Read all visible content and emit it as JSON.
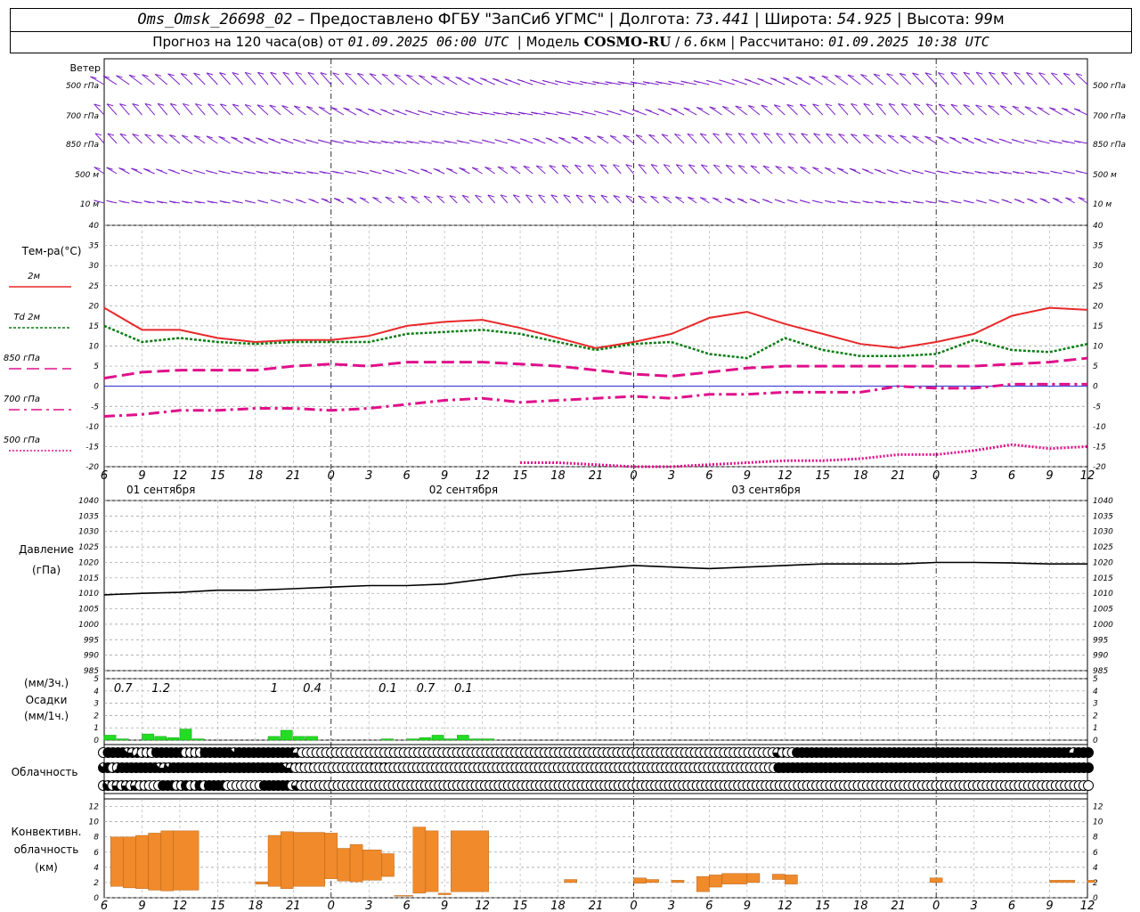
{
  "header": {
    "station": "Oms_Omsk_26698_02",
    "sep": " – ",
    "provider": "Предоставлено ФГБУ \"ЗапСиб УГМС\"",
    "lon_label": "Долгота:",
    "lon": "73.441",
    "lat_label": "Широта:",
    "lat": "54.925",
    "alt_label": "Высота:",
    "alt": "99",
    "alt_unit": "м",
    "forecast_label": "Прогноз на 120 часа(ов) от",
    "forecast_start": "01.09.2025 06:00 UTC",
    "model_label": "Модель",
    "model": "COSMO-RU",
    "resolution": "6.6",
    "resolution_unit": "км",
    "calc_label": "Рассчитано:",
    "calc_time": "01.09.2025 10:38 UTC"
  },
  "colors": {
    "wind": "#7b20c8",
    "t2m": "#e8282a",
    "td2m": "#0a7d14",
    "t850": "#e0108a",
    "t700": "#e0108a",
    "t500": "#e0108a",
    "pressure": "#000000",
    "precip": "#22dd22",
    "convective": "#f08a2a",
    "zero_line": "#2020d0"
  },
  "chart_data": [
    {
      "type": "wind_barbs",
      "title": "Ветер",
      "levels": [
        "500 гПа",
        "700 гПа",
        "850 гПа",
        "500 м",
        "10 м"
      ]
    },
    {
      "type": "line",
      "ylabel": "Тем-ра(°C)",
      "ylim": [
        -20,
        40
      ],
      "yticks": [
        -20,
        -15,
        -10,
        -5,
        0,
        5,
        10,
        15,
        20,
        25,
        30,
        35,
        40
      ],
      "x_hours": [
        0,
        3,
        6,
        9,
        12,
        15,
        18,
        21,
        24,
        27,
        30,
        33,
        36,
        39,
        42,
        45,
        48,
        51,
        54,
        57,
        60,
        63,
        66,
        69,
        72,
        75,
        78
      ],
      "x_tick_labels": [
        "6",
        "9",
        "12",
        "15",
        "18",
        "21",
        "0",
        "3",
        "6",
        "9",
        "12",
        "15",
        "18",
        "21",
        "0",
        "3",
        "6",
        "9",
        "12",
        "15",
        "18",
        "21",
        "0",
        "3",
        "6",
        "9",
        "12"
      ],
      "date_labels": [
        "01 сентября",
        "02 сентября",
        "03 сентября"
      ],
      "grid": true,
      "series": [
        {
          "name": "2м",
          "values": [
            19.5,
            14,
            14,
            12,
            11,
            11.5,
            11.5,
            12.5,
            15,
            16,
            16.5,
            14.5,
            12,
            9.5,
            11,
            13,
            17,
            18.5,
            15.5,
            13,
            10.5,
            9.5,
            11,
            13,
            17.5,
            19.5,
            19
          ]
        },
        {
          "name": "Td 2м",
          "values": [
            15,
            11,
            12,
            11,
            10.5,
            11,
            11,
            11,
            13,
            13.5,
            14,
            13,
            11,
            9,
            10.5,
            11,
            8,
            7,
            12,
            9,
            7.5,
            7.5,
            8,
            11.5,
            9,
            8.5,
            10.5
          ]
        },
        {
          "name": "850 гПа",
          "values": [
            2,
            3.5,
            4,
            4,
            4,
            5,
            5.5,
            5,
            6,
            6,
            6,
            5.5,
            5,
            4,
            3,
            2.5,
            3.5,
            4.5,
            5,
            5,
            5,
            5,
            5,
            5,
            5.5,
            6,
            7
          ]
        },
        {
          "name": "700 гПа",
          "values": [
            -7.5,
            -7,
            -6,
            -6,
            -5.5,
            -5.5,
            -6,
            -5.5,
            -4.5,
            -3.5,
            -3,
            -4,
            -3.5,
            -3,
            -2.5,
            -3,
            -2,
            -2,
            -1.5,
            -1.5,
            -1.5,
            0,
            -0.5,
            -0.5,
            0.5,
            0.5,
            0.5
          ]
        },
        {
          "name": "500 гПа",
          "values": [
            null,
            null,
            null,
            null,
            null,
            null,
            null,
            null,
            null,
            null,
            null,
            -19,
            -19,
            -19.5,
            -20,
            -20,
            -19.5,
            -19,
            -18.5,
            -18.5,
            -18,
            -17,
            -17,
            -16,
            -14.5,
            -15.5,
            -15
          ]
        }
      ]
    },
    {
      "type": "line",
      "ylabel": "Давление",
      "unit": "(гПа)",
      "ylim": [
        985,
        1040
      ],
      "yticks": [
        985,
        990,
        995,
        1000,
        1005,
        1010,
        1015,
        1020,
        1025,
        1030,
        1035,
        1040
      ],
      "grid": true,
      "series": [
        {
          "values": [
            1009.5,
            1010,
            1010.3,
            1011,
            1011,
            1011.5,
            1012,
            1012.5,
            1012.5,
            1013,
            1014.5,
            1016,
            1017,
            1018,
            1019,
            1018.5,
            1018,
            1018.5,
            1019,
            1019.5,
            1019.5,
            1019.5,
            1020,
            1020,
            1019.8,
            1019.5,
            1019.5
          ]
        }
      ]
    },
    {
      "type": "bar",
      "ylabel": "Осадки",
      "unit_top": "(мм/3ч.)",
      "unit_bottom": "(мм/1ч.)",
      "ylim": [
        0,
        5
      ],
      "yticks": [
        0,
        1,
        2,
        3,
        4,
        5
      ],
      "bars": [
        {
          "hour": 0,
          "value": 0.4
        },
        {
          "hour": 1,
          "value": 0.1
        },
        {
          "hour": 3,
          "value": 0.5
        },
        {
          "hour": 4,
          "value": 0.3
        },
        {
          "hour": 5,
          "value": 0.2
        },
        {
          "hour": 6,
          "value": 0.9
        },
        {
          "hour": 7,
          "value": 0.1
        },
        {
          "hour": 13,
          "value": 0.3
        },
        {
          "hour": 14,
          "value": 0.8
        },
        {
          "hour": 15,
          "value": 0.3
        },
        {
          "hour": 16,
          "value": 0.3
        },
        {
          "hour": 22,
          "value": 0.1
        },
        {
          "hour": 24,
          "value": 0.1
        },
        {
          "hour": 25,
          "value": 0.2
        },
        {
          "hour": 26,
          "value": 0.4
        },
        {
          "hour": 27,
          "value": 0.1
        },
        {
          "hour": 28,
          "value": 0.4
        },
        {
          "hour": 29,
          "value": 0.1
        },
        {
          "hour": 30,
          "value": 0.1
        }
      ],
      "labels": [
        {
          "hour": 1.5,
          "text": "0.7"
        },
        {
          "hour": 4.5,
          "text": "1.2"
        },
        {
          "hour": 13.5,
          "text": "1"
        },
        {
          "hour": 16.5,
          "text": "0.4"
        },
        {
          "hour": 22.5,
          "text": "0.1"
        },
        {
          "hour": 25.5,
          "text": "0.7"
        },
        {
          "hour": 28.5,
          "text": "0.1"
        }
      ]
    },
    {
      "type": "table",
      "title": "Облачность",
      "rows_octas": [
        [
          0,
          8,
          8,
          8,
          8,
          7,
          6,
          5,
          4,
          4,
          2,
          8,
          8,
          8,
          8,
          8,
          8,
          4,
          4,
          4,
          4,
          8,
          8,
          8,
          8,
          8,
          8,
          7,
          8,
          8,
          8,
          8,
          8,
          8,
          8,
          8,
          8,
          8,
          8,
          8,
          6,
          0,
          0,
          0,
          0,
          0,
          0,
          0,
          0,
          0,
          0,
          0,
          0,
          0,
          0,
          0,
          0,
          0,
          0,
          0,
          0,
          0,
          0,
          0,
          0,
          0,
          0,
          0,
          0,
          0,
          0,
          0,
          0,
          0,
          0,
          0,
          0,
          0,
          0,
          0,
          0,
          0,
          0,
          0,
          0,
          0,
          0,
          0,
          0,
          0,
          0,
          0,
          0,
          0,
          0,
          0,
          0,
          0,
          0,
          0,
          0,
          0,
          0,
          0,
          0,
          0,
          0,
          0,
          0,
          0,
          0,
          0,
          0,
          0,
          0,
          0,
          0,
          0,
          0,
          0,
          0,
          0,
          0,
          0,
          0,
          0,
          0,
          0,
          0,
          0,
          0,
          0,
          0,
          0,
          0,
          0,
          0,
          0,
          0,
          6,
          4,
          0,
          0,
          8,
          8,
          8,
          8,
          8,
          8,
          8,
          8,
          8,
          8,
          8,
          8,
          8,
          8,
          8,
          8,
          8,
          8,
          8,
          8,
          8,
          8,
          8,
          8,
          8,
          8,
          8,
          8,
          8,
          8,
          8,
          8,
          8,
          8,
          8,
          8,
          8,
          8,
          8,
          8,
          8,
          8,
          8,
          8,
          8,
          8,
          8,
          8,
          8,
          8,
          8,
          8,
          8,
          8,
          8,
          8,
          8,
          6,
          8,
          8,
          8
        ],
        [
          7,
          8,
          4,
          5,
          8,
          8,
          8,
          8,
          8,
          8,
          8,
          8,
          7,
          6,
          7,
          8,
          8,
          8,
          8,
          8,
          8,
          8,
          8,
          8,
          8,
          8,
          8,
          8,
          8,
          8,
          8,
          8,
          8,
          8,
          8,
          8,
          8,
          8,
          8,
          7,
          6,
          2,
          2,
          0,
          2,
          0,
          0,
          0,
          0,
          0,
          0,
          0,
          0,
          0,
          0,
          0,
          0,
          2,
          0,
          2,
          2,
          0,
          0,
          0,
          0,
          0,
          0,
          0,
          0,
          0,
          0,
          0,
          0,
          0,
          0,
          0,
          0,
          0,
          0,
          0,
          0,
          0,
          0,
          0,
          0,
          0,
          0,
          0,
          0,
          0,
          0,
          0,
          0,
          0,
          0,
          0,
          0,
          0,
          0,
          0,
          0,
          0,
          0,
          0,
          0,
          0,
          0,
          0,
          0,
          0,
          0,
          0,
          0,
          0,
          0,
          0,
          0,
          0,
          0,
          0,
          0,
          0,
          0,
          0,
          0,
          0,
          0,
          0,
          0,
          0,
          0,
          0,
          0,
          0,
          0,
          0,
          0,
          0,
          0,
          0,
          0,
          0,
          0,
          0,
          8,
          8,
          8,
          8,
          8,
          8,
          8,
          8,
          8,
          8,
          8,
          8,
          8,
          8,
          8,
          8,
          8,
          8,
          8,
          8,
          8,
          8,
          8,
          8,
          8,
          8,
          8,
          8,
          8,
          8,
          8,
          8,
          8,
          8,
          8,
          8,
          8,
          8,
          8,
          8,
          8,
          8,
          8,
          8,
          8,
          8,
          8,
          8,
          8,
          8,
          8,
          8,
          8,
          8,
          8,
          8,
          8,
          8,
          8,
          8,
          8,
          8,
          8,
          8,
          8,
          8,
          8
        ],
        [
          4,
          7,
          4,
          6,
          4,
          6,
          4,
          6,
          4,
          4,
          0,
          0,
          0,
          8,
          8,
          8,
          4,
          4,
          8,
          4,
          4,
          8,
          4,
          8,
          8,
          8,
          8,
          0,
          0,
          0,
          0,
          0,
          0,
          0,
          0,
          8,
          8,
          8,
          8,
          8,
          8,
          0,
          6,
          0,
          2,
          0,
          0,
          0,
          0,
          0,
          0,
          0,
          0,
          0,
          0,
          0,
          0,
          0,
          0,
          0,
          0,
          0,
          0,
          0,
          0,
          0,
          0,
          0,
          0,
          0,
          0,
          0,
          0,
          0,
          0,
          0,
          0,
          0,
          0,
          0,
          0,
          0,
          0,
          0,
          0,
          0,
          0,
          0,
          0,
          0,
          0,
          0,
          0,
          0,
          0,
          0,
          0,
          0,
          0,
          0,
          0,
          0,
          0,
          0,
          0,
          0,
          0,
          0,
          0,
          0,
          0,
          0,
          0,
          0,
          0,
          0,
          0,
          0,
          0,
          0,
          0,
          0,
          0,
          0,
          0,
          0,
          0,
          0,
          0,
          0,
          0,
          0,
          0,
          0,
          0,
          0,
          0,
          0,
          0,
          0,
          0,
          0,
          0,
          0,
          0,
          0,
          0,
          0,
          0,
          0,
          0,
          0,
          0,
          0,
          0,
          0,
          0,
          0,
          0,
          0,
          0,
          0,
          0,
          0,
          0,
          0,
          0,
          0,
          0,
          0,
          0,
          0,
          0,
          0,
          0,
          0,
          0,
          0,
          0,
          0,
          0,
          0,
          0,
          0,
          0,
          0,
          0,
          0,
          0,
          0,
          0,
          0,
          0,
          0,
          0,
          0,
          0,
          0,
          0,
          0,
          0,
          0,
          0,
          0,
          0,
          0,
          0,
          0,
          0,
          0,
          0,
          0,
          0,
          0,
          0
        ]
      ]
    },
    {
      "type": "bar",
      "ylabel": "Конвективн. облачность",
      "unit": "(км)",
      "ylim": [
        0,
        13
      ],
      "yticks": [
        0,
        2,
        4,
        6,
        8,
        10,
        12
      ],
      "bars": [
        {
          "h0": 0.5,
          "h1": 1.5,
          "base": 1.5,
          "top": 8
        },
        {
          "h0": 1.5,
          "h1": 2.5,
          "base": 1.3,
          "top": 8
        },
        {
          "h0": 2.5,
          "h1": 3.5,
          "base": 1.2,
          "top": 8.2
        },
        {
          "h0": 3.5,
          "h1": 4.5,
          "base": 1,
          "top": 8.5
        },
        {
          "h0": 4.5,
          "h1": 5.5,
          "base": 0.9,
          "top": 8.8
        },
        {
          "h0": 5.5,
          "h1": 7.5,
          "base": 1,
          "top": 8.8
        },
        {
          "h0": 12,
          "h1": 13,
          "base": 1.8,
          "top": 2.1
        },
        {
          "h0": 13,
          "h1": 14,
          "base": 1.5,
          "top": 8.2
        },
        {
          "h0": 14,
          "h1": 15,
          "base": 1.2,
          "top": 8.7
        },
        {
          "h0": 15,
          "h1": 17.5,
          "base": 1.5,
          "top": 8.6
        },
        {
          "h0": 17.5,
          "h1": 18.5,
          "base": 2.5,
          "top": 8.5
        },
        {
          "h0": 18.5,
          "h1": 19.5,
          "base": 2.2,
          "top": 6.5
        },
        {
          "h0": 19.5,
          "h1": 20.5,
          "base": 2.1,
          "top": 7
        },
        {
          "h0": 20.5,
          "h1": 22,
          "base": 2.3,
          "top": 6.3
        },
        {
          "h0": 22,
          "h1": 23,
          "base": 2.8,
          "top": 5.8
        },
        {
          "h0": 23,
          "h1": 24.5,
          "base": 0.2,
          "top": 0.3
        },
        {
          "h0": 24.5,
          "h1": 25.5,
          "base": 0.6,
          "top": 9.3
        },
        {
          "h0": 25.5,
          "h1": 26.5,
          "base": 0.8,
          "top": 8.8
        },
        {
          "h0": 26.5,
          "h1": 27.5,
          "base": 0.4,
          "top": 0.6
        },
        {
          "h0": 27.5,
          "h1": 30.5,
          "base": 0.8,
          "top": 8.8
        },
        {
          "h0": 36.5,
          "h1": 37.5,
          "base": 2,
          "top": 2.4
        },
        {
          "h0": 42,
          "h1": 43,
          "base": 1.9,
          "top": 2.6
        },
        {
          "h0": 43,
          "h1": 44,
          "base": 2,
          "top": 2.4
        },
        {
          "h0": 45,
          "h1": 46,
          "base": 2,
          "top": 2.3
        },
        {
          "h0": 47,
          "h1": 48,
          "base": 0.8,
          "top": 2.8
        },
        {
          "h0": 48,
          "h1": 49,
          "base": 1.4,
          "top": 3
        },
        {
          "h0": 49,
          "h1": 51,
          "base": 1.8,
          "top": 3.2
        },
        {
          "h0": 51,
          "h1": 52,
          "base": 2,
          "top": 3.2
        },
        {
          "h0": 53,
          "h1": 54,
          "base": 2.4,
          "top": 3.1
        },
        {
          "h0": 54,
          "h1": 55,
          "base": 1.8,
          "top": 3
        },
        {
          "h0": 65.5,
          "h1": 66.5,
          "base": 2,
          "top": 2.6
        },
        {
          "h0": 75,
          "h1": 77,
          "base": 2,
          "top": 2.3
        },
        {
          "h0": 78,
          "h1": 78.6,
          "base": 2,
          "top": 2.3
        }
      ]
    }
  ]
}
